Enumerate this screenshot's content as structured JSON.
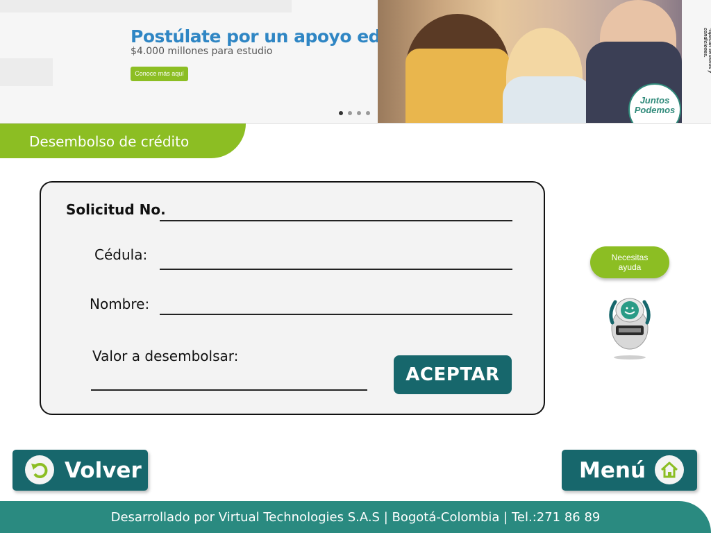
{
  "banner": {
    "title": "Postúlate por un apoyo educativo",
    "subtitle": "$4.000 millones para estudio",
    "cta_label": "Conoce más aquí",
    "seal_text": "Juntos Podemos",
    "terms_text": "*Aplican términos y condiciones.",
    "slide_count": 4,
    "active_slide": 1
  },
  "section": {
    "title": "Desembolso de crédito"
  },
  "form": {
    "request_label": "Solicitud No.",
    "id_label": "Cédula:",
    "name_label": "Nombre:",
    "amount_label": "Valor a desembolsar:",
    "accept_label": "ACEPTAR"
  },
  "help": {
    "label_line1": "Necesitas",
    "label_line2": "ayuda"
  },
  "nav": {
    "back_label": "Volver",
    "menu_label": "Menú"
  },
  "footer": {
    "text": "Desarrollado por Virtual Technologies S.A.S | Bogotá-Colombia | Tel.:271 86 89"
  },
  "colors": {
    "primary": "#17676c",
    "accent": "#8cbe23",
    "footer": "#2a8a80",
    "card_bg": "#f3f3f3"
  }
}
